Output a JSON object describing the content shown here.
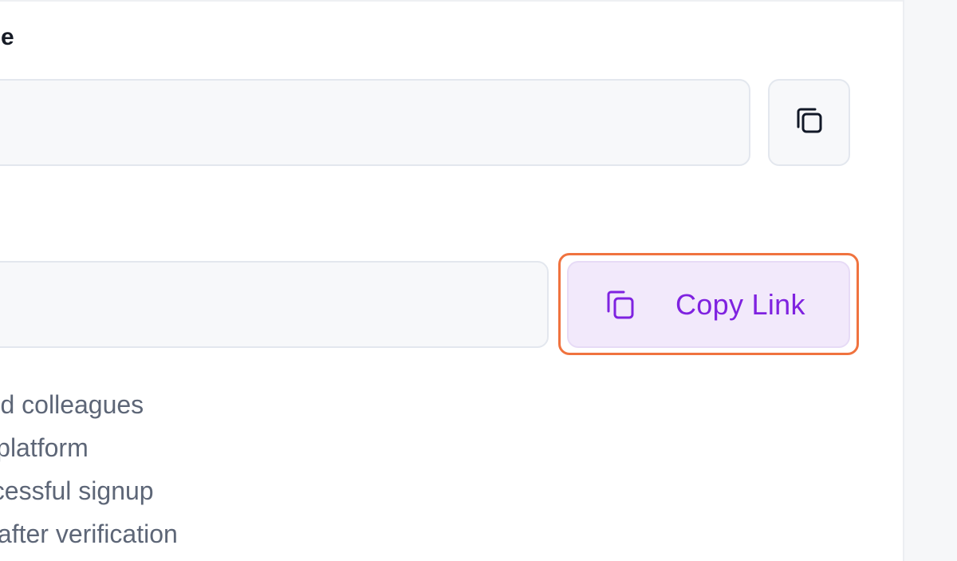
{
  "form": {
    "referral_code": {
      "label": "ode",
      "value": "",
      "copy_icon": "copy-icon"
    },
    "referral_link": {
      "label": "",
      "value": "",
      "button_label": "Copy Link",
      "button_icon": "copy-icon"
    }
  },
  "instructions": {
    "items": [
      "s and colleagues",
      "our platform",
      "successful signup",
      "ally after verification"
    ]
  },
  "colors": {
    "accent": "#7f22e0",
    "button_bg": "#f2e9fb",
    "highlight": "#f0733f",
    "muted_text": "#5d6677"
  }
}
